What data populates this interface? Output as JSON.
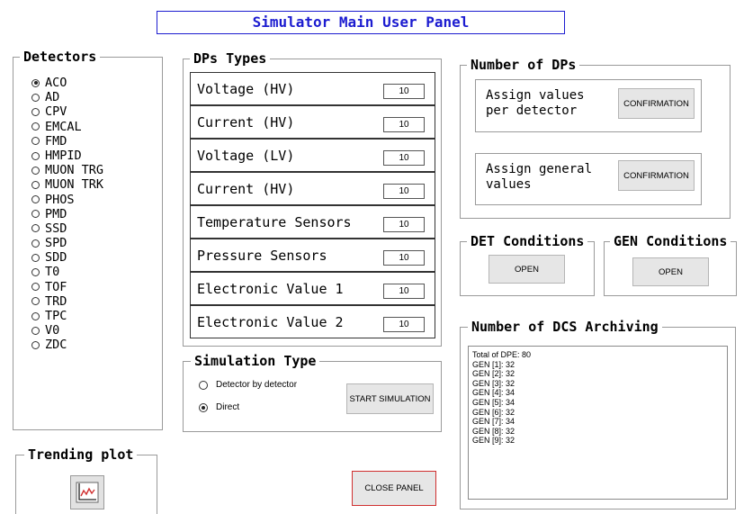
{
  "title": "Simulator Main User Panel",
  "detectors": {
    "label": "Detectors",
    "items": [
      "ACO",
      "AD",
      "CPV",
      "EMCAL",
      "FMD",
      "HMPID",
      "MUON TRG",
      "MUON TRK",
      "PHOS",
      "PMD",
      "SSD",
      "SPD",
      "SDD",
      "T0",
      "TOF",
      "TRD",
      "TPC",
      "V0",
      "ZDC"
    ],
    "selected": "ACO"
  },
  "dp_types": {
    "label": "DPs Types",
    "rows": [
      {
        "label": "Voltage (HV)",
        "value": "10"
      },
      {
        "label": "Current (HV)",
        "value": "10"
      },
      {
        "label": "Voltage (LV)",
        "value": "10"
      },
      {
        "label": "Current (HV)",
        "value": "10"
      },
      {
        "label": "Temperature Sensors",
        "value": "10"
      },
      {
        "label": "Pressure Sensors",
        "value": "10"
      },
      {
        "label": "Electronic Value 1",
        "value": "10"
      },
      {
        "label": "Electronic Value 2",
        "value": "10"
      }
    ]
  },
  "number_of_dps": {
    "label": "Number of DPs",
    "per_detector_text": "Assign values\nper detector",
    "per_detector_button": "CONFIRMATION",
    "general_text": "Assign general\nvalues",
    "general_button": "CONFIRMATION"
  },
  "det_conditions": {
    "label": "DET Conditions",
    "button": "OPEN"
  },
  "gen_conditions": {
    "label": "GEN Conditions",
    "button": "OPEN"
  },
  "simulation_type": {
    "label": "Simulation Type",
    "options": [
      "Detector by detector",
      "Direct"
    ],
    "selected": "Direct",
    "start_button": "START SIMULATION"
  },
  "dcs_archiving": {
    "label": "Number of DCS Archiving",
    "lines": [
      "Total of DPE: 80",
      "GEN [1]: 32",
      "GEN [2]: 32",
      "GEN [3]: 32",
      "GEN [4]: 34",
      "GEN [5]: 34",
      "GEN [6]: 32",
      "GEN [7]: 34",
      "GEN [8]: 32",
      "GEN [9]: 32"
    ]
  },
  "trending_plot": {
    "label": "Trending plot",
    "icon": "trend-chart-icon"
  },
  "close_button": "CLOSE PANEL",
  "colors": {
    "title": "#1c1cd0",
    "close_border": "#d03030",
    "trend_line": "#d03030"
  }
}
